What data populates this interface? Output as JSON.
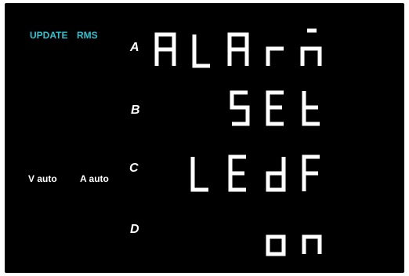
{
  "indicators": {
    "update": "UPDATE",
    "rms": "RMS",
    "v_auto": "V auto",
    "a_auto": "A auto"
  },
  "rows": [
    {
      "label": "A",
      "value": "ALArm"
    },
    {
      "label": "B",
      "value": "SEt"
    },
    {
      "label": "C",
      "value": "LEdF"
    },
    {
      "label": "D",
      "value": "on"
    }
  ],
  "colors": {
    "background": "#000000",
    "indicator_cyan": "#2bc4d2",
    "segment": "#ffffff"
  }
}
